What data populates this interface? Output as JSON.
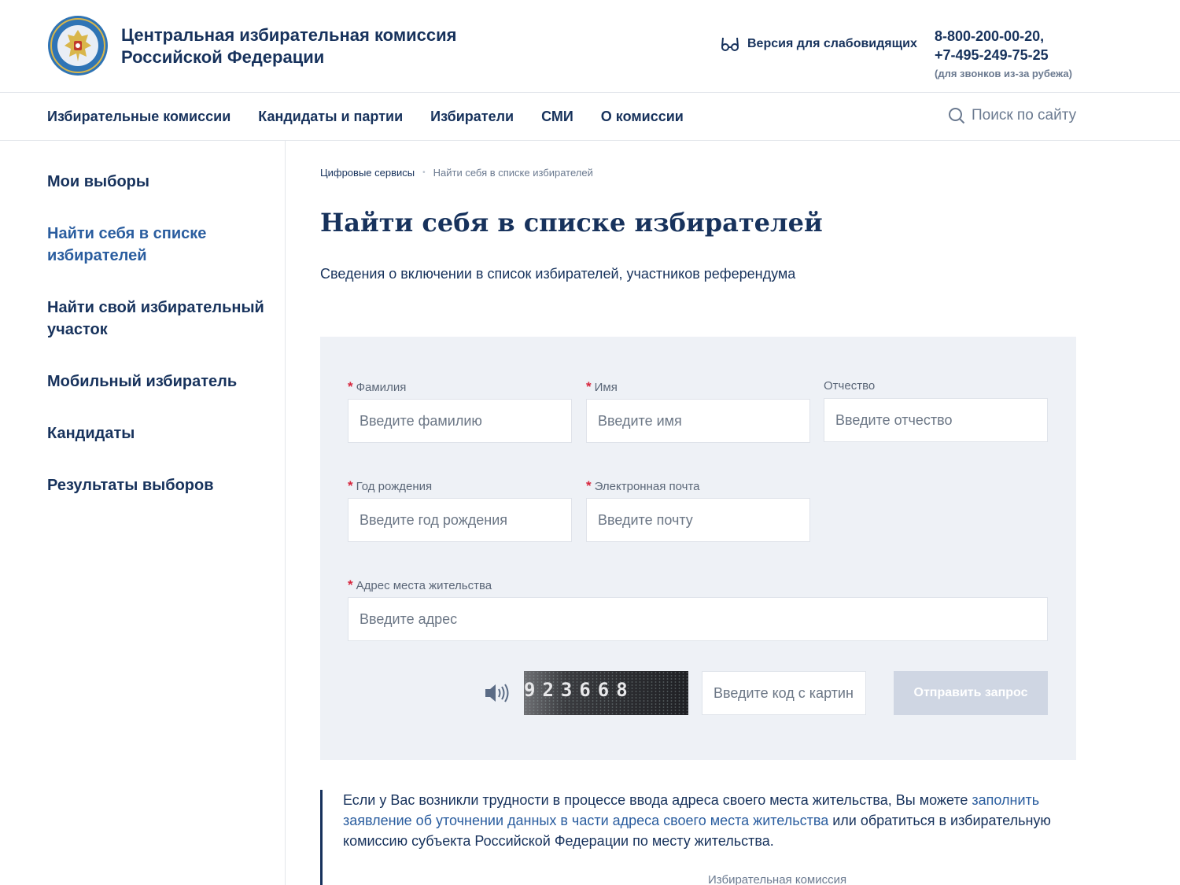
{
  "header": {
    "org_name_line1": "Центральная избирательная комиссия",
    "org_name_line2": "Российской Федерации",
    "vision_label": "Версия для слабовидящих",
    "phone1": "8-800-200-00-20,",
    "phone2": "+7-495-249-75-25",
    "phone_note": "(для звонков из-за рубежа)"
  },
  "nav": {
    "items": [
      {
        "label": "Избирательные комиссии"
      },
      {
        "label": "Кандидаты и партии"
      },
      {
        "label": "Избиратели"
      },
      {
        "label": "СМИ"
      },
      {
        "label": "О комиссии"
      }
    ],
    "search_placeholder": "Поиск по сайту"
  },
  "sidebar": {
    "items": [
      {
        "label": "Мои выборы"
      },
      {
        "label": "Найти себя в списке избирателей",
        "active": true
      },
      {
        "label": "Найти свой избирательный участок"
      },
      {
        "label": "Мобильный избиратель"
      },
      {
        "label": "Кандидаты"
      },
      {
        "label": "Результаты выборов"
      }
    ]
  },
  "breadcrumb": {
    "parent": "Цифровые сервисы",
    "separator": "•",
    "current": "Найти себя в списке избирателей"
  },
  "main": {
    "title": "Найти себя в списке избирателей",
    "subtitle": "Сведения о включении в список избирателей, участников референдума"
  },
  "form": {
    "required_mark": "*",
    "surname": {
      "label": "Фамилия",
      "placeholder": "Введите фамилию",
      "required": true
    },
    "name": {
      "label": "Имя",
      "placeholder": "Введите имя",
      "required": true
    },
    "patronymic": {
      "label": "Отчество",
      "placeholder": "Введите отчество",
      "required": false
    },
    "birth_year": {
      "label": "Год рождения",
      "placeholder": "Введите год рождения",
      "required": true
    },
    "email": {
      "label": "Электронная почта",
      "placeholder": "Введите почту",
      "required": true
    },
    "address": {
      "label": "Адрес места жительства",
      "placeholder": "Введите адрес",
      "required": true
    },
    "captcha_code": "923668",
    "captcha_placeholder": "Введите код с картин",
    "submit_label": "Отправить запрос"
  },
  "note": {
    "text_before": "Если у Вас возникли трудности в процессе ввода адреса своего места жительства, Вы можете ",
    "link": "заполнить заявление об уточнении данных в части адреса своего места жительства",
    "text_after": " или обратиться в избирательную комиссию субъекта Российской Федерации по месту жительства.",
    "cut_label": "Избирательная комиссия"
  },
  "colors": {
    "primary": "#17325c",
    "accent_link": "#2a5d9f",
    "required": "#d7263d",
    "panel_bg": "#eef1f6",
    "button_disabled": "#cfd6e3"
  },
  "icons": {
    "logo": "cec-emblem-icon",
    "vision": "glasses-icon",
    "search": "search-icon",
    "sound": "speaker-icon"
  }
}
